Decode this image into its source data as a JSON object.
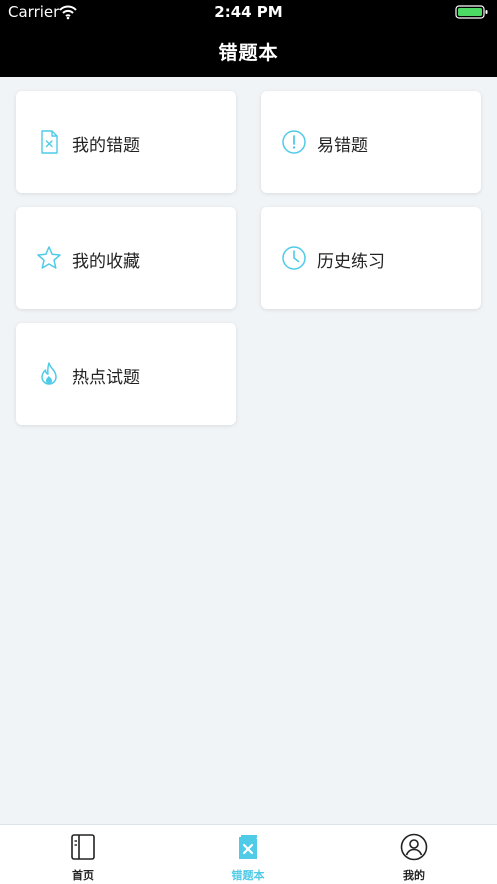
{
  "status_bar": {
    "carrier": "Carrier",
    "time": "2:44 PM"
  },
  "header": {
    "title": "错题本"
  },
  "grid": {
    "items": [
      {
        "label": "我的错题",
        "icon": "wrong-doc-icon"
      },
      {
        "label": "易错题",
        "icon": "exclamation-icon"
      },
      {
        "label": "我的收藏",
        "icon": "star-icon"
      },
      {
        "label": "历史练习",
        "icon": "clock-icon"
      },
      {
        "label": "热点试题",
        "icon": "flame-icon"
      }
    ]
  },
  "tabbar": {
    "items": [
      {
        "label": "首页",
        "icon": "book-icon",
        "active": false
      },
      {
        "label": "错题本",
        "icon": "wrongbook-icon",
        "active": true
      },
      {
        "label": "我的",
        "icon": "user-icon",
        "active": false
      }
    ]
  },
  "colors": {
    "accent": "#4fcbe8",
    "background": "#f1f4f6",
    "navbar": "#000000"
  }
}
